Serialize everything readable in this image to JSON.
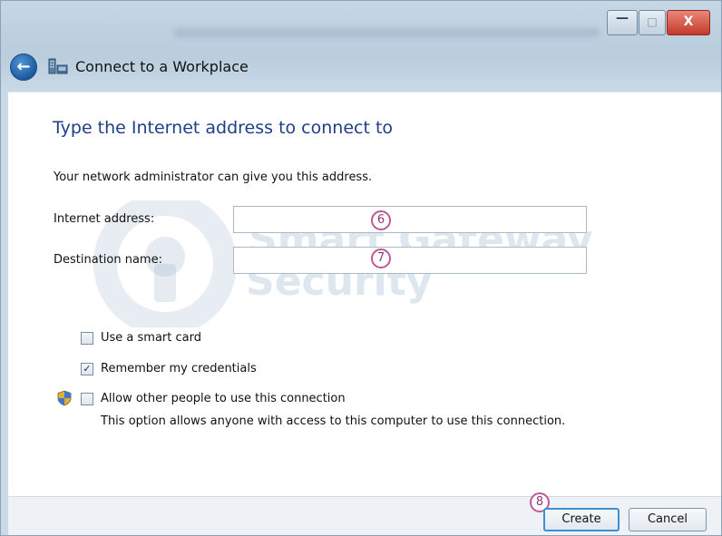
{
  "window": {
    "title": "Connect to a Workplace",
    "controls": {
      "minimize": "—",
      "maximize": "□",
      "close": "X"
    }
  },
  "content": {
    "heading": "Type the Internet address to connect to",
    "description": "Your network administrator can give you this address.",
    "internet_address": {
      "label": "Internet address:",
      "value": "",
      "step": "6"
    },
    "destination_name": {
      "label": "Destination name:",
      "value": "",
      "step": "7"
    },
    "options": [
      {
        "label": "Use a smart card",
        "checked": false
      },
      {
        "label": "Remember my credentials",
        "checked": true
      },
      {
        "label": "Allow other people to use this connection",
        "checked": false
      }
    ],
    "allow_note": "This option allows anyone with access to this computer to use this connection."
  },
  "watermark": {
    "line1": "Smart Gateway",
    "line2": "Security"
  },
  "footer": {
    "create_step": "8",
    "create_label": "Create",
    "cancel_label": "Cancel"
  },
  "colors": {
    "heading": "#1e3f87",
    "accent": "#3d8fd0",
    "close_button": "#c4392a",
    "step_marker": "#c0579a"
  },
  "icons": [
    "back-arrow-icon",
    "network-workplace-icon",
    "uac-shield-icon",
    "checkmark-icon"
  ]
}
